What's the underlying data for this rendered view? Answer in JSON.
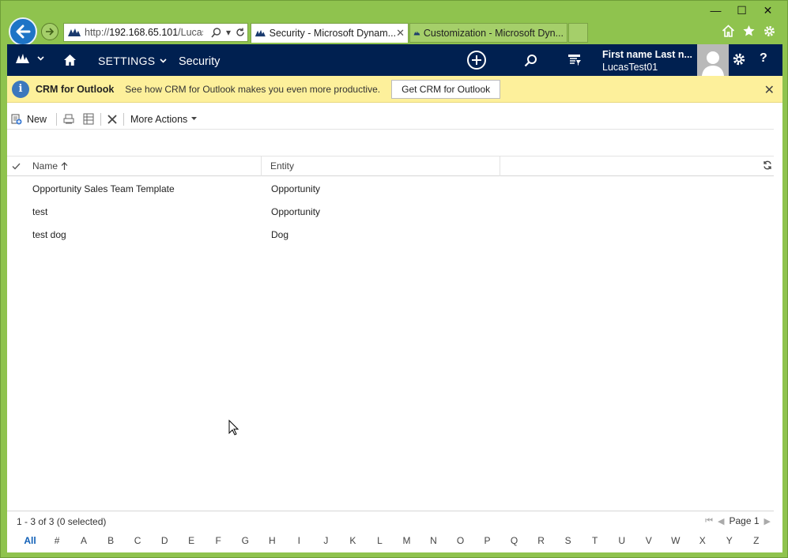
{
  "window": {
    "minimize": "—",
    "maximize": "☐",
    "close": "✕"
  },
  "browser": {
    "url_prefix": "http://",
    "url_host": "192.168.65.101",
    "url_path": "/LucasT",
    "tabs": [
      {
        "label": "Security - Microsoft Dynam...",
        "active": true
      },
      {
        "label": "Customization - Microsoft Dyn...",
        "active": false
      }
    ],
    "tab_close": "✕"
  },
  "navbar": {
    "settings_label": "SETTINGS",
    "area_label": "Security",
    "user_name": "First name Last n...",
    "user_id": "LucasTest01",
    "help": "?"
  },
  "notification": {
    "title": "CRM for Outlook",
    "message": "See how CRM for Outlook makes you even more productive.",
    "button": "Get CRM for Outlook",
    "close": "✕"
  },
  "commands": {
    "new": "New",
    "more_actions": "More Actions"
  },
  "grid": {
    "columns": [
      "Name",
      "Entity"
    ],
    "rows": [
      {
        "name": "Opportunity Sales Team Template",
        "entity": "Opportunity"
      },
      {
        "name": "test",
        "entity": "Opportunity"
      },
      {
        "name": "test dog",
        "entity": "Dog"
      }
    ]
  },
  "footer": {
    "status": "1 - 3 of 3 (0 selected)",
    "page": "Page 1",
    "alphabet": [
      "All",
      "#",
      "A",
      "B",
      "C",
      "D",
      "E",
      "F",
      "G",
      "H",
      "I",
      "J",
      "K",
      "L",
      "M",
      "N",
      "O",
      "P",
      "Q",
      "R",
      "S",
      "T",
      "U",
      "V",
      "W",
      "X",
      "Y",
      "Z"
    ],
    "selected_letter": "All"
  },
  "colors": {
    "frame": "#8fc34e",
    "navbar": "#002050",
    "notification": "#fdf09b",
    "accent": "#1160b7"
  }
}
